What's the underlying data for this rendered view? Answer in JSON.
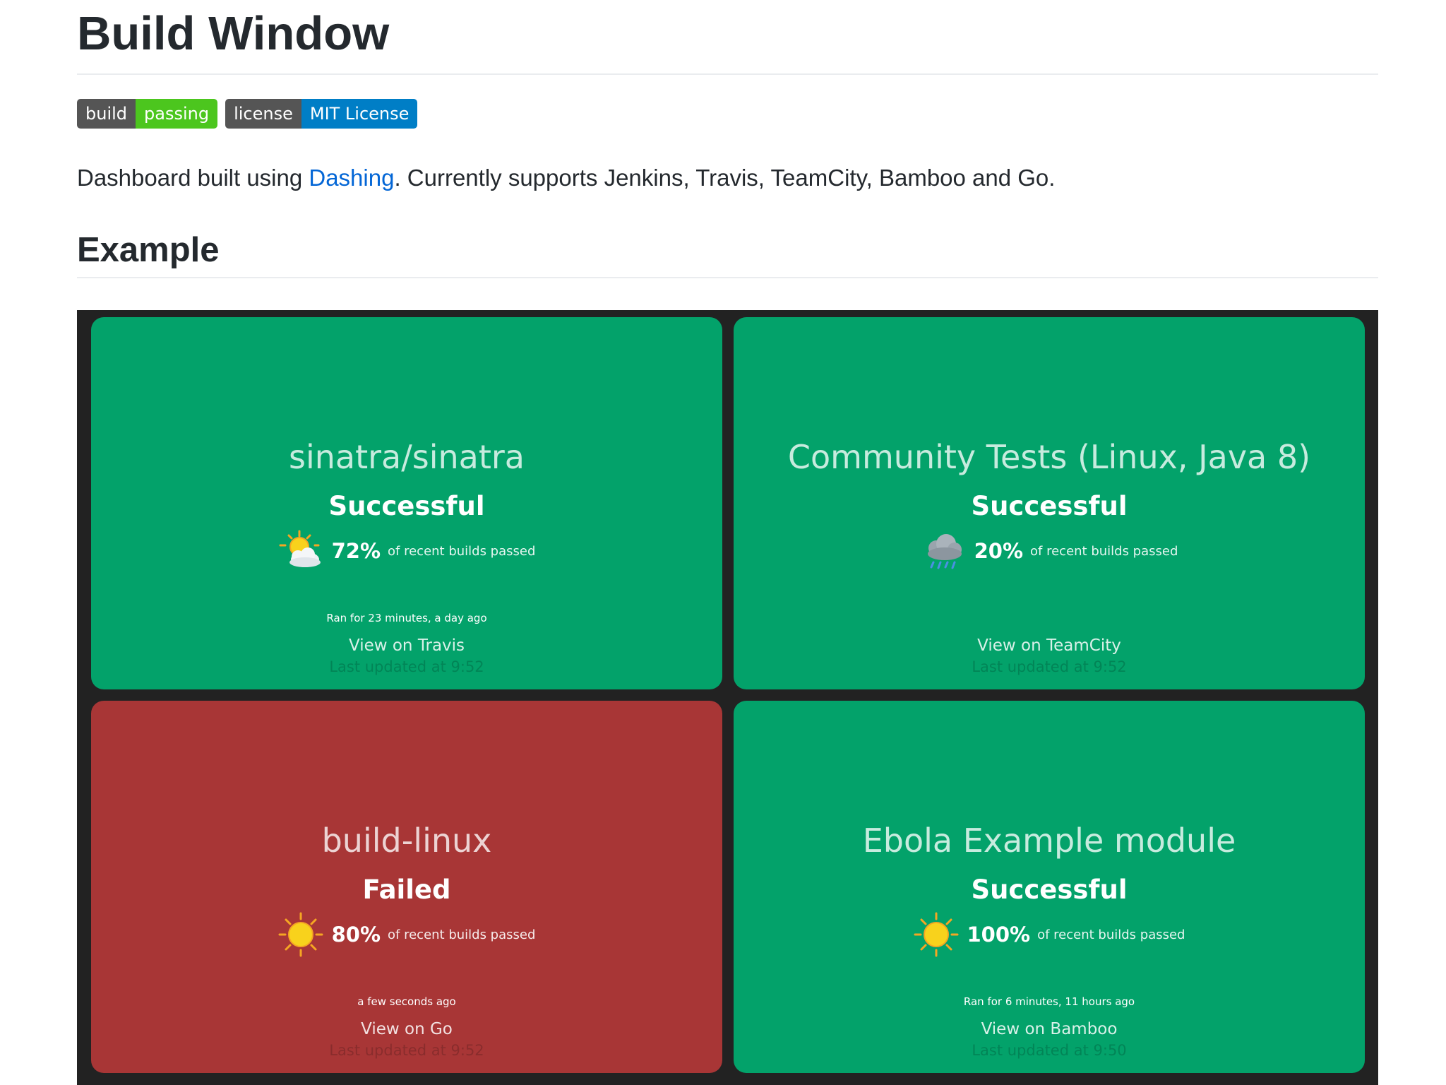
{
  "header": {
    "title": "Build Window"
  },
  "badges": [
    {
      "label": "build",
      "value": "passing",
      "color": "#4cc61e"
    },
    {
      "label": "license",
      "value": "MIT License",
      "color": "#007ec6"
    }
  ],
  "description": {
    "before": "Dashboard built using ",
    "link": "Dashing",
    "after": ". Currently supports Jenkins, Travis, TeamCity, Bamboo and Go."
  },
  "section": {
    "title": "Example"
  },
  "colors": {
    "success": "#03a26a",
    "failed": "#a83636",
    "dashboard_bg": "#222222",
    "link": "#0366d6"
  },
  "widgets": [
    {
      "name": "sinatra/sinatra",
      "status": "Successful",
      "health_icon": "sun-cloud-icon",
      "percent": "72%",
      "caption": "of recent builds passed",
      "duration": "Ran for 23 minutes, a day ago",
      "link": "View on Travis",
      "updated": "Last updated at 9:52"
    },
    {
      "name": "Community Tests (Linux, Java 8)",
      "status": "Successful",
      "health_icon": "rain-cloud-icon",
      "percent": "20%",
      "caption": "of recent builds passed",
      "duration": "",
      "link": "View on TeamCity",
      "updated": "Last updated at 9:52"
    },
    {
      "name": "build-linux",
      "status": "Failed",
      "health_icon": "sun-icon",
      "percent": "80%",
      "caption": "of recent builds passed",
      "duration": "a few seconds ago",
      "link": "View on Go",
      "updated": "Last updated at 9:52"
    },
    {
      "name": "Ebola Example module",
      "status": "Successful",
      "health_icon": "sun-icon",
      "percent": "100%",
      "caption": "of recent builds passed",
      "duration": "Ran for 6 minutes, 11 hours ago",
      "link": "View on Bamboo",
      "updated": "Last updated at 9:50"
    }
  ]
}
